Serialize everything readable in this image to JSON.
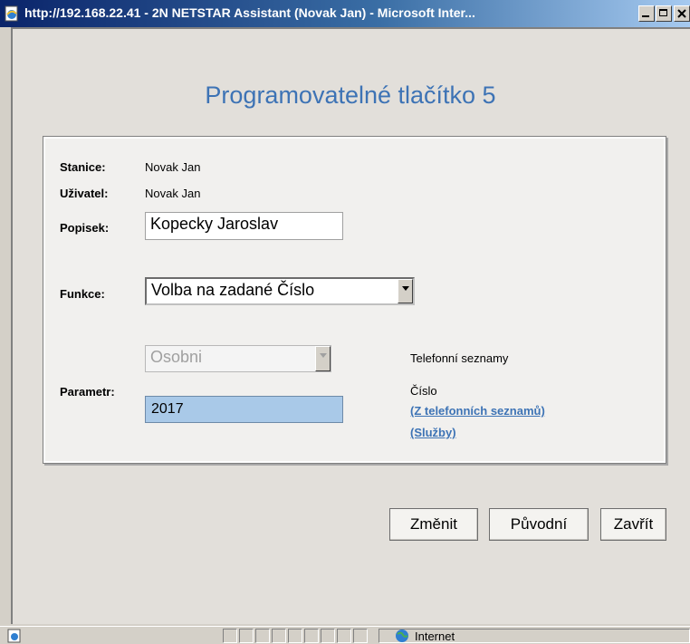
{
  "window": {
    "title": "http://192.168.22.41 - 2N NETSTAR Assistant (Novak Jan) - Microsoft Inter...",
    "controls": [
      "minimize",
      "maximize",
      "close"
    ]
  },
  "page": {
    "heading": "Programovatelné tlačítko 5",
    "fields": {
      "stanice_label": "Stanice:",
      "stanice_value": "Novak Jan",
      "uzivatel_label": "Uživatel:",
      "uzivatel_value": "Novak Jan",
      "popisek_label": "Popisek:",
      "popisek_value": "Kopecky Jaroslav",
      "funkce_label": "Funkce:",
      "funkce_value": "Volba na zadané Číslo",
      "parametr_label": "Parametr:",
      "phonebook_select_value": "Osobni",
      "cislo_value": "2017"
    },
    "side": {
      "phonebooks_label": "Telefonní seznamy",
      "number_label": "Číslo",
      "link_phonebooks": "(Z telefonních seznamů)",
      "link_services": "(Služby)"
    },
    "buttons": {
      "change": "Změnit",
      "original": "Původní",
      "close": "Zavřít"
    }
  },
  "statusbar": {
    "zone": "Internet"
  },
  "colors": {
    "accent": "#3d73b5",
    "selected_field": "#a9c9e8",
    "titlebar_start": "#0a246a"
  }
}
